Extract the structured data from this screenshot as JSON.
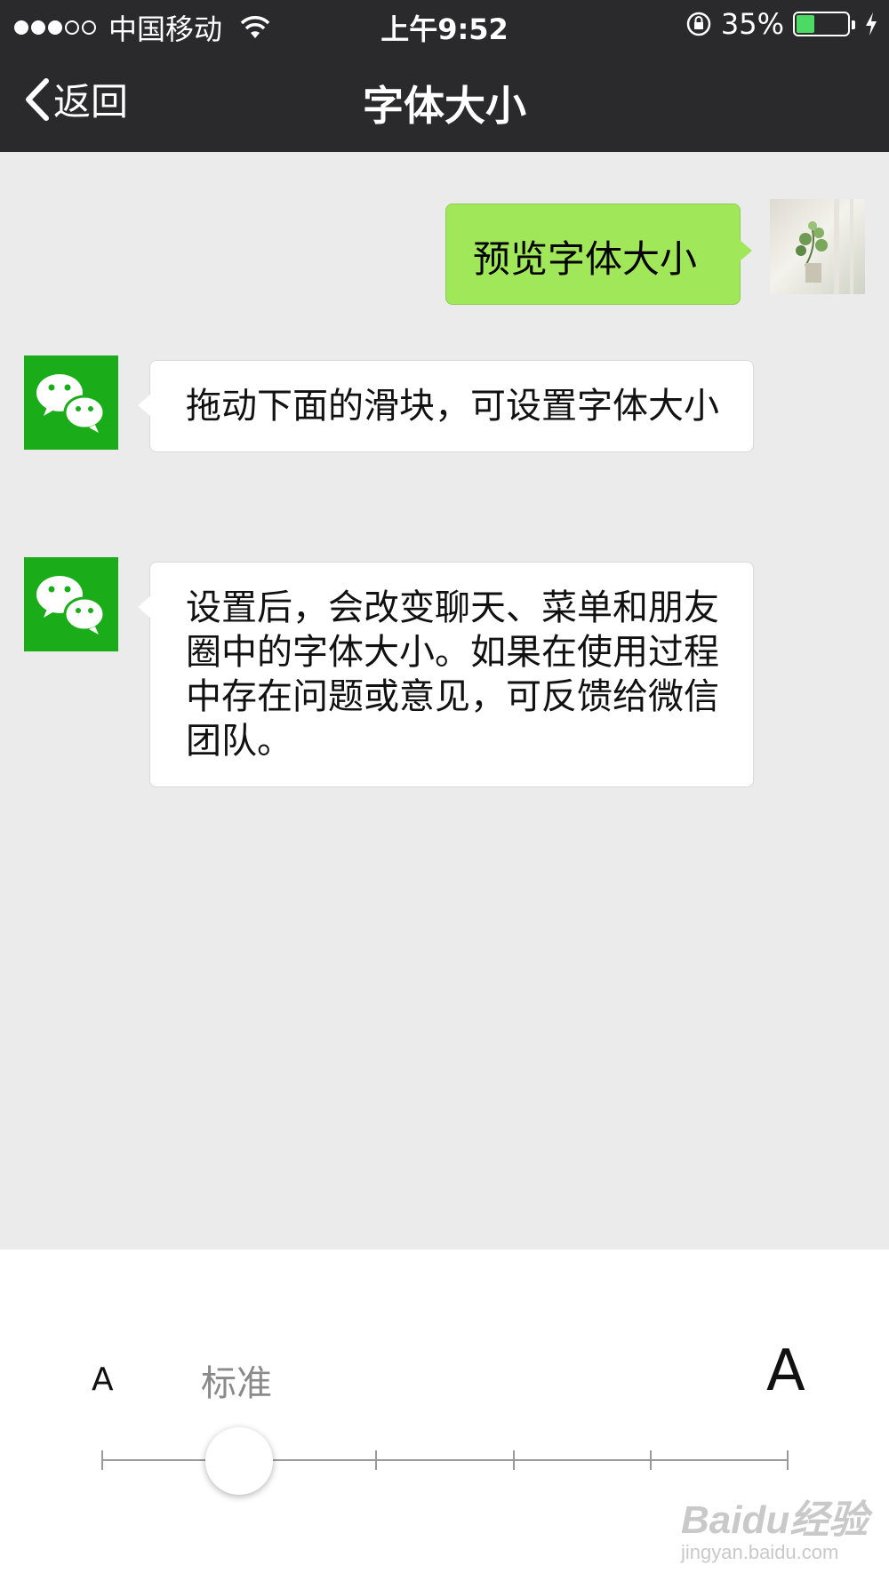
{
  "status_bar": {
    "carrier": "中国移动",
    "time": "上午9:52",
    "battery_percent": "35%",
    "battery_level": 0.35,
    "signal_bars": 3,
    "signal_total": 5
  },
  "nav": {
    "back_label": "返回",
    "title": "字体大小"
  },
  "messages": [
    {
      "from": "me",
      "text": "预览字体大小"
    },
    {
      "from": "wechat",
      "text": "拖动下面的滑块，可设置字体大小"
    },
    {
      "from": "wechat",
      "text": "设置后，会改变聊天、菜单和朋友圈中的字体大小。如果在使用过程中存在问题或意见，可反馈给微信团队。"
    }
  ],
  "font_slider": {
    "small_label": "A",
    "large_label": "A",
    "current_label": "标准",
    "steps": 6,
    "current_step": 2
  },
  "watermark": {
    "brand": "Baidu经验",
    "url": "jingyan.baidu.com"
  },
  "colors": {
    "bar_bg": "#2a2a2c",
    "chat_bg": "#ebebeb",
    "my_bubble": "#a0e75a",
    "wechat_green": "#1aad19",
    "battery_fill": "#4cd964"
  }
}
